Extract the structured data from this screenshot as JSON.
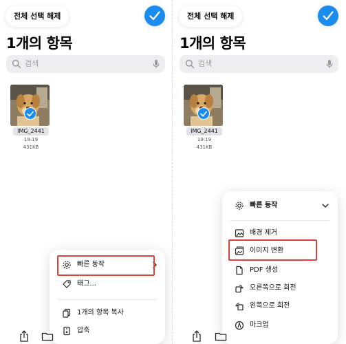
{
  "left": {
    "deselect_label": "전체 선택 해제",
    "title": "1개의 항목",
    "search_placeholder": "검색",
    "file": {
      "name": "IMG_2441",
      "time": "19:19",
      "size": "431KB"
    },
    "menu": {
      "quick_actions": "빠른 동작",
      "tags": "태그...",
      "copy": "1개의 항목 복사",
      "compress": "압축"
    }
  },
  "right": {
    "deselect_label": "전체 선택 해제",
    "title": "1개의 항목",
    "search_placeholder": "검색",
    "file": {
      "name": "IMG_2441",
      "time": "19:19",
      "size": "431KB"
    },
    "menu": {
      "quick_actions": "빠른 동작",
      "remove_background": "배경 제거",
      "convert_image": "이미지 변환",
      "create_pdf": "PDF 생성",
      "rotate_right": "오른쪽으로 회전",
      "rotate_left": "왼쪽으로 회전",
      "markup": "마크업"
    }
  },
  "colors": {
    "accent": "#1a8cf0",
    "highlight": "#e0403c"
  }
}
